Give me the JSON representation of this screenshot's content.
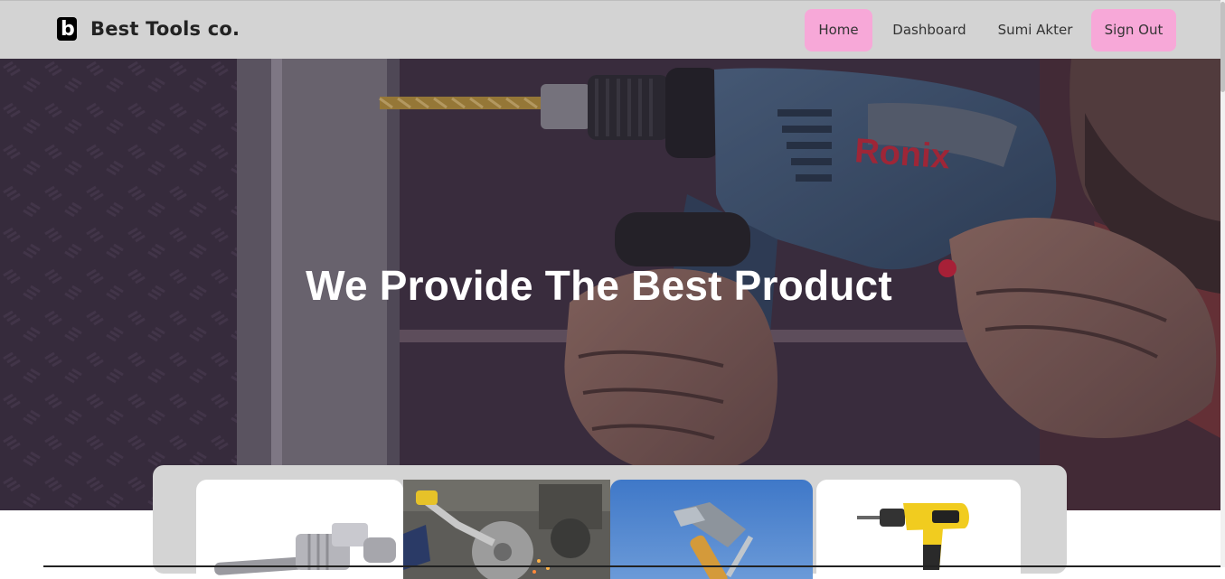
{
  "brand": {
    "logo_letter": "b",
    "name": "Best Tools co."
  },
  "nav": {
    "home": "Home",
    "dashboard": "Dashboard",
    "user": "Sumi Akter",
    "sign_out": "Sign Out"
  },
  "hero": {
    "title": "We Provide The Best Product",
    "drill_brand": "Ronix"
  },
  "colors": {
    "navbar_bg": "#d3d3d3",
    "pill_pink": "#f7a8d8",
    "panel_gray": "#d4d4d4"
  },
  "products": [
    {
      "icon": "pipe-wrench-icon"
    },
    {
      "icon": "angle-grinder-icon"
    },
    {
      "icon": "hammer-icon"
    },
    {
      "icon": "cordless-drill-icon"
    }
  ]
}
